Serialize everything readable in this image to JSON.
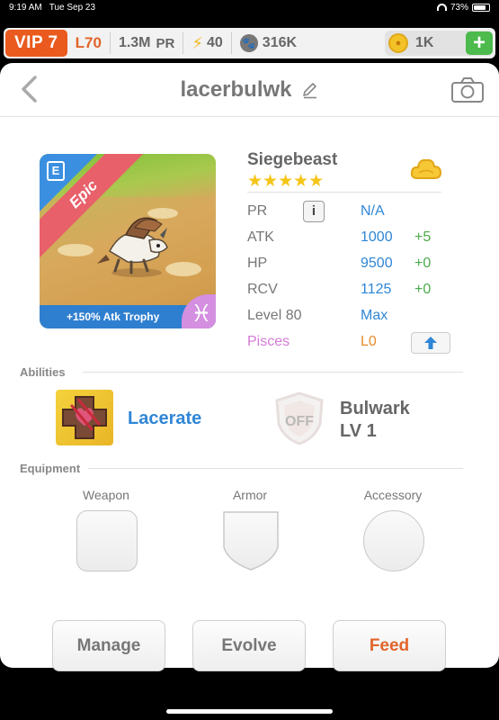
{
  "status_bar": {
    "time": "9:19 AM",
    "date": "Tue Sep 23",
    "battery": "73%"
  },
  "resources": {
    "vip": "VIP 7",
    "level": "L70",
    "power": "1.3M",
    "power_unit": "PR",
    "energy": "40",
    "paw": "316K",
    "coins": "1K"
  },
  "header": {
    "title": "lacerbulwk"
  },
  "monster": {
    "name": "Siegebeast",
    "rarity": "Epic",
    "rarity_badge": "E",
    "stars": "★★★★★",
    "trophy": "+150% Atk Trophy",
    "zodiac_symbol": "♓"
  },
  "stats": [
    {
      "label": "PR",
      "value": "N/A",
      "bonus": ""
    },
    {
      "label": "ATK",
      "value": "1000",
      "bonus": "+5"
    },
    {
      "label": "HP",
      "value": "9500",
      "bonus": "+0"
    },
    {
      "label": "RCV",
      "value": "1125",
      "bonus": "+0"
    },
    {
      "label": "Level 80",
      "value": "Max",
      "bonus": ""
    },
    {
      "label": "Pisces",
      "value": "L0",
      "bonus": ""
    }
  ],
  "stat_colors": {
    "pisces_label": "#d37ad6",
    "pisces_value": "#e88a2a"
  },
  "abilities": {
    "section_label": "Abilities",
    "ability1": {
      "name": "Lacerate",
      "icon": "lacerate-icon"
    },
    "ability2": {
      "name_line1": "Bulwark",
      "name_line2": "LV 1",
      "state": "OFF",
      "icon": "bulwark-icon"
    }
  },
  "equipment": {
    "section_label": "Equipment",
    "slots": [
      "Weapon",
      "Armor",
      "Accessory"
    ]
  },
  "buttons": {
    "manage": "Manage",
    "evolve": "Evolve",
    "feed": "Feed"
  },
  "colors": {
    "accent_blue": "#2f86d6",
    "feed_orange": "#e2642a",
    "vip_orange": "#ea5a1e",
    "plus_green": "#4cba4d"
  }
}
